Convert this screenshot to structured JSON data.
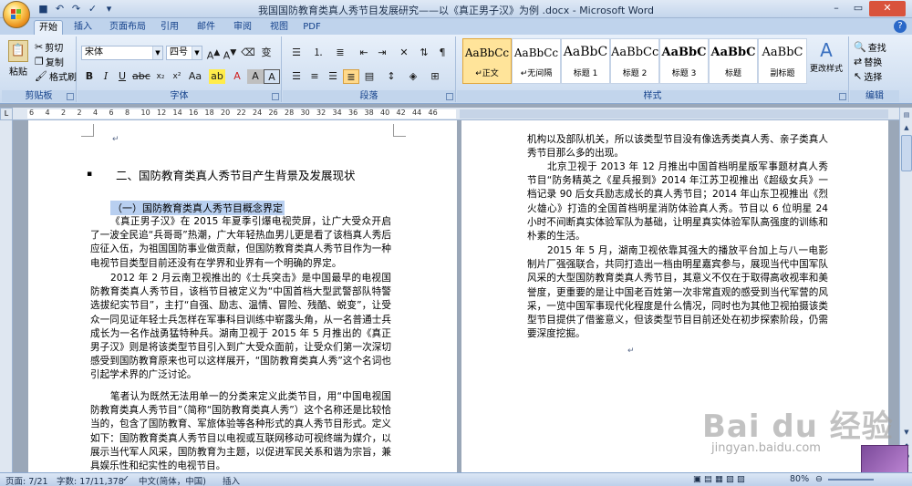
{
  "window": {
    "title": "我国国防教育类真人秀节目发展研究——以《真正男子汉》为例 .docx - Microsoft Word"
  },
  "tabs": [
    "开始",
    "插入",
    "页面布局",
    "引用",
    "邮件",
    "审阅",
    "视图",
    "PDF"
  ],
  "ribbon": {
    "clipboard": {
      "paste": "粘贴",
      "cut": "剪切",
      "copy": "复制",
      "format_painter": "格式刷",
      "label": "剪贴板"
    },
    "font": {
      "name": "宋体",
      "size": "四号",
      "label": "字体"
    },
    "paragraph": {
      "label": "段落"
    },
    "styles": {
      "items": [
        {
          "sample": "AaBbCc",
          "name": "↵正文"
        },
        {
          "sample": "AaBbCc",
          "name": "↵无间隔"
        },
        {
          "sample": "AaBbC",
          "name": "标题 1"
        },
        {
          "sample": "AaBbCc",
          "name": "标题 2"
        },
        {
          "sample": "AaBbC",
          "name": "标题 3"
        },
        {
          "sample": "AaBbC",
          "name": "标题"
        },
        {
          "sample": "AaBbC",
          "name": "副标题"
        }
      ],
      "change_styles": "更改样式",
      "label": "样式"
    },
    "editing": {
      "find": "查找",
      "replace": "替换",
      "select": "选择",
      "label": "编辑"
    }
  },
  "ruler": {
    "ticks": [
      "6",
      "4",
      "2",
      "2",
      "4",
      "6",
      "8",
      "10",
      "12",
      "14",
      "16",
      "18",
      "20",
      "22",
      "24",
      "26",
      "28",
      "30",
      "32",
      "34",
      "36",
      "38",
      "40",
      "42",
      "44",
      "46"
    ]
  },
  "document": {
    "page1": {
      "heading": "二、国防教育类真人秀节目产生背景及发展现状",
      "subheading": "（一）国防教育类真人秀节目概念界定",
      "paragraphs": [
        "《真正男子汉》在 2015 年夏季引爆电视荧屏，让广大受众开启了一波全民追“兵哥哥”热潮，广大年轻热血男儿更是看了该档真人秀后应征入伍，为祖国国防事业做贡献，但国防教育类真人秀节目作为一种电视节目类型目前还没有在学界和业界有一个明确的界定。",
        "2012 年 2 月云南卫视推出的《士兵突击》是中国最早的电视国防教育类真人秀节目，该档节目被定义为“中国首档大型武警部队特警选拔纪实节目”，主打“自强、励志、温情、冒险、残酷、蜕变”，让受众一同见证年轻士兵怎样在军事科目训练中崭露头角，从一名普通士兵成长为一名作战勇猛特种兵。湖南卫视于 2015 年 5 月推出的《真正男子汉》则是将该类型节目引入到广大受众面前，让受众们第一次深切感受到国防教育原来也可以这样展开，“国防教育类真人秀”这个名词也引起学术界的广泛讨论。",
        "笔者认为既然无法用单一的分类来定义此类节目，用“中国电视国防教育类真人秀节目”（简称“国防教育类真人秀”）这个名称还是比较恰当的，包含了国防教育、军旅体验等各种形式的真人秀节目形式。定义如下：国防教育类真人秀节目以电视或互联网移动可视终端为媒介，以展示当代军人风采，国防教育为主题，以促进军民关系和谐为宗旨，兼具娱乐性和纪实性的电视节目。"
      ]
    },
    "page2": {
      "paragraphs": [
        "机构以及部队机关，所以该类型节目没有像选秀类真人秀、亲子类真人秀节目那么多的出现。",
        "北京卫视于 2013 年 12 月推出中国首档明星版军事题材真人秀节目“防务精英之《星兵报到》2014 年江苏卫视推出《超级女兵》一档记录 90 后女兵励志成长的真人秀节目；2014 年山东卫视推出《烈火雄心》打造的全国首档明星消防体验真人秀。节目以 6 位明星 24 小时不间断真实体验军队为基础，让明星真实体验军队高强度的训练和朴素的生活。",
        "2015 年 5 月，湖南卫视依靠其强大的播放平台加上与八一电影制片厂强强联合，共同打造出一档由明星嘉宾参与，展现当代中国军队风采的大型国防教育类真人秀节目，其意义不仅在于取得高收视率和美誉度，更重要的是让中国老百姓第一次非常直观的感受到当代军营的风采，一览中国军事现代化程度是什么情况，同时也为其他卫视拍摄该类型节目提供了借鉴意义，但该类型节目目前还处在初步探索阶段，仍需要深度挖掘。"
      ]
    }
  },
  "status": {
    "page": "页面: 7/21",
    "words": "字数: 17/11,378",
    "language": "中文(简体，中国)",
    "mode": "插入",
    "zoom": "80%"
  },
  "watermark": {
    "logo": "Bai du 经验",
    "url": "jingyan.baidu.com"
  },
  "colors": {
    "ribbon_bg": "#d6e3f3",
    "tab_text": "#15428b",
    "selection": "#b8cff0",
    "doc_bg": "#9aa7b8"
  }
}
